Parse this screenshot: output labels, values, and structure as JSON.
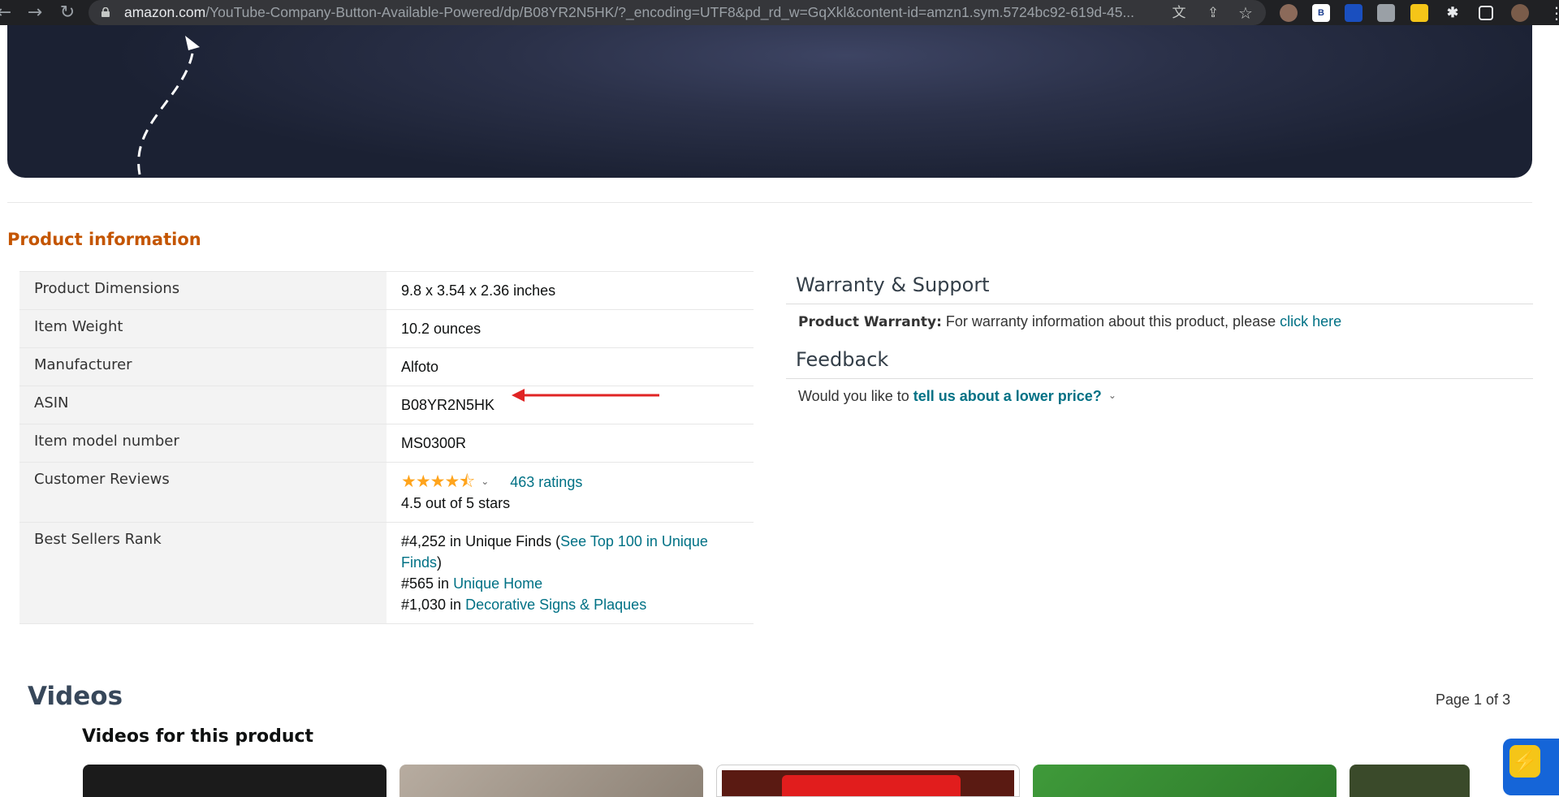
{
  "browser": {
    "url_host": "amazon.com",
    "url_path": "/YouTube-Company-Button-Available-Powered/dp/B08YR2N5HK/?_encoding=UTF8&pd_rd_w=GqXkl&content-id=amzn1.sym.5724bc92-619d-45...",
    "back_icon": "←",
    "forward_icon": "→",
    "reload_icon": "↻",
    "translate_icon": "文",
    "share_icon": "⇪",
    "star_icon": "☆",
    "ext_b_label": "B",
    "menu_icon": "⋮"
  },
  "product_info": {
    "title": "Product information",
    "rows": [
      {
        "label": "Product Dimensions",
        "value": "9.8 x 3.54 x 2.36 inches"
      },
      {
        "label": "Item Weight",
        "value": "10.2 ounces"
      },
      {
        "label": "Manufacturer",
        "value": "Alfoto"
      },
      {
        "label": "ASIN",
        "value": "B08YR2N5HK"
      },
      {
        "label": "Item model number",
        "value": "MS0300R"
      }
    ],
    "reviews": {
      "label": "Customer Reviews",
      "stars": "★★★★⯪",
      "rating_count": "463 ratings",
      "rating_text": "4.5 out of 5 stars"
    },
    "rank": {
      "label": "Best Sellers Rank",
      "line1_rank": "#4,252 in Unique Finds (",
      "line1_link": "See Top 100 in Unique Finds",
      "line1_close": ")",
      "line2_rank": "#565 in ",
      "line2_link": "Unique Home",
      "line3_rank": "#1,030 in ",
      "line3_link": "Decorative Signs & Plaques"
    }
  },
  "warranty": {
    "heading": "Warranty & Support",
    "label": "Product Warranty:",
    "text": " For warranty information about this product, please ",
    "link": "click here"
  },
  "feedback": {
    "heading": "Feedback",
    "prefix": "Would you like to ",
    "link": "tell us about a lower price?",
    "chevron": "⌄"
  },
  "videos": {
    "title": "Videos",
    "page": "Page 1 of 3",
    "subtitle": "Videos for this product"
  },
  "colors": {
    "section_title": "#c45500",
    "link": "#007185",
    "star": "#ffa41c",
    "annotation_arrow": "#e02424"
  }
}
